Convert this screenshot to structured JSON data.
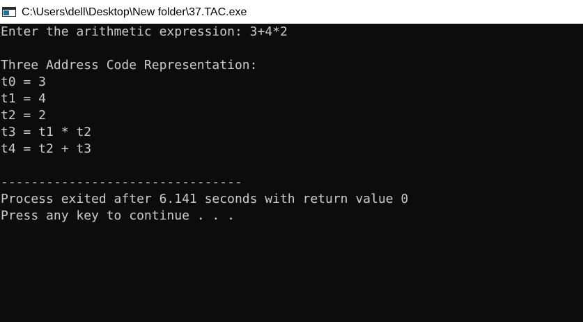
{
  "window": {
    "title": "C:\\Users\\dell\\Desktop\\New folder\\37.TAC.exe"
  },
  "console": {
    "lines": [
      "Enter the arithmetic expression: 3+4*2",
      "",
      "Three Address Code Representation:",
      "t0 = 3",
      "t1 = 4",
      "t2 = 2",
      "t3 = t1 * t2",
      "t4 = t2 + t3",
      "",
      "--------------------------------",
      "Process exited after 6.141 seconds with return value 0",
      "Press any key to continue . . ."
    ]
  }
}
